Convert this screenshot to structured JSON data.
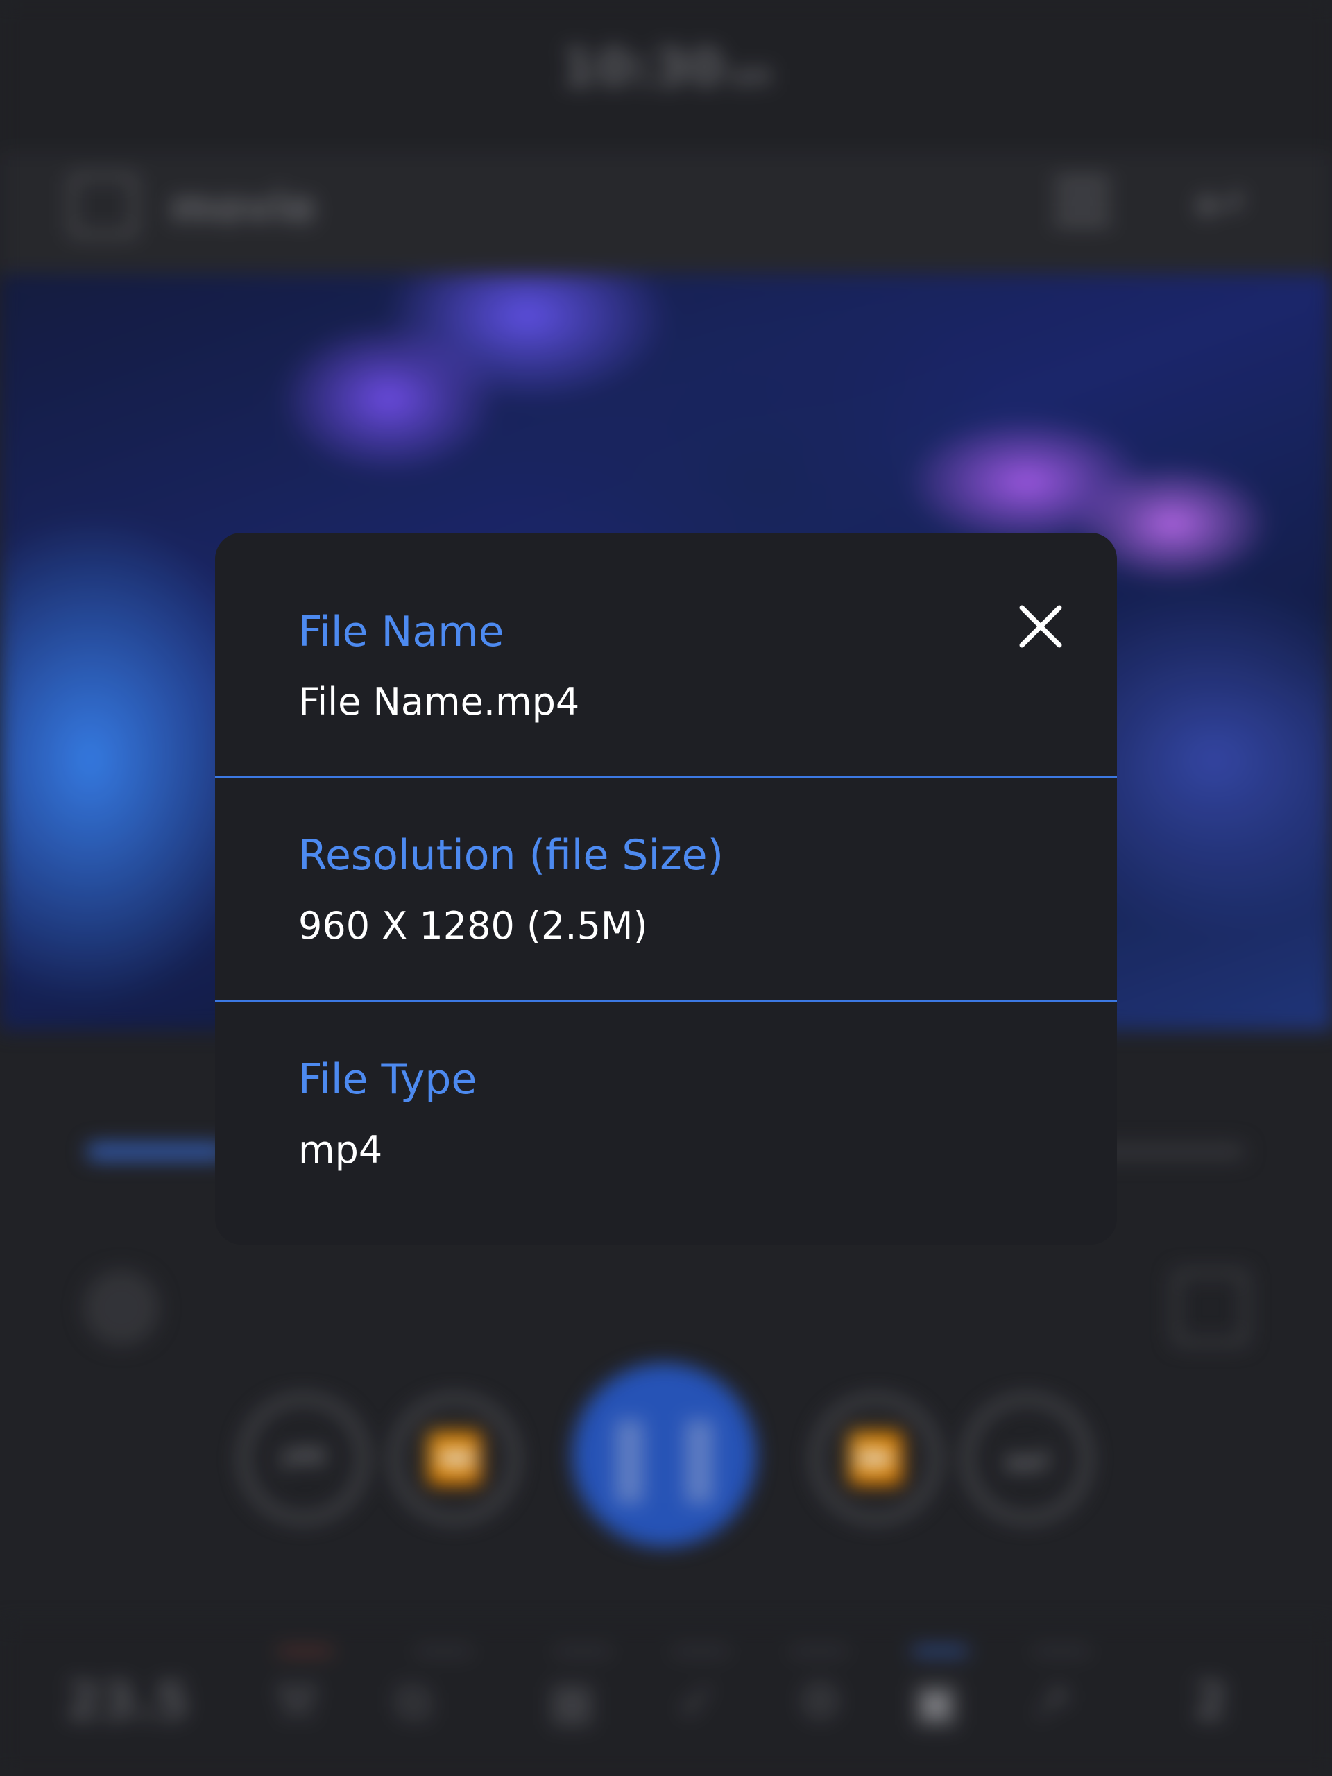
{
  "background": {
    "status_bar": {
      "time": "10:30",
      "ampm": "AM"
    },
    "app_bar": {
      "title": "movie"
    },
    "player": {
      "progress_fraction": 0.12
    },
    "toolbar": {
      "left_value": "23.5",
      "right_value": "2"
    }
  },
  "dialog": {
    "file_name": {
      "label": "File Name",
      "value": "File Name.mp4"
    },
    "resolution": {
      "label": "Resolution (file Size)",
      "value": "960 X 1280 (2.5M)"
    },
    "file_type": {
      "label": "File Type",
      "value": "mp4"
    },
    "close_icon": "close-icon"
  },
  "colors": {
    "accent": "#4d8af0",
    "dialog_background": "#1e1f24",
    "value_text": "#ffffff",
    "play_button": "#2c5fd0"
  }
}
